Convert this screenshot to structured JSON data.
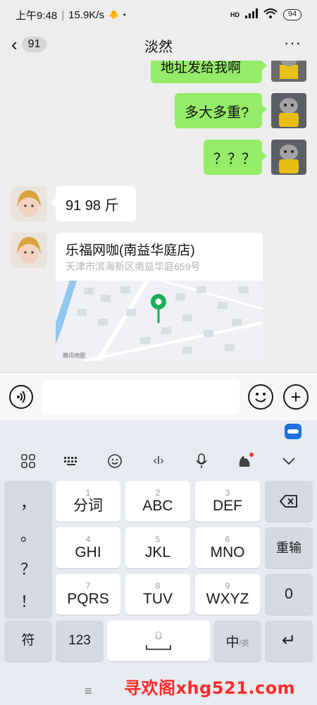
{
  "status_bar": {
    "time": "上午9:48",
    "speed": "15.9K/s",
    "network": "HD",
    "battery": "94"
  },
  "header": {
    "back_count": "91",
    "title": "淡然"
  },
  "messages": {
    "m0": "地址发给我啊",
    "m1": "多大多重?",
    "m2": "？？？",
    "m3": "91  98 斤",
    "location": {
      "name": "乐福网咖(南益华庭店)",
      "address": "天津市滨海新区南益华庭659号",
      "map_credit": "腾讯地图"
    }
  },
  "input": {
    "placeholder": ""
  },
  "keyboard": {
    "toolbar": [
      "grid-icon",
      "keyboard-icon",
      "emoji-icon",
      "cursor-icon",
      "mic-icon",
      "skin-icon",
      "collapse-icon"
    ],
    "symbols": [
      "，",
      "。",
      "？",
      "！"
    ],
    "keys": [
      {
        "num": "1",
        "label": "分词"
      },
      {
        "num": "2",
        "label": "ABC"
      },
      {
        "num": "3",
        "label": "DEF"
      },
      {
        "num": "4",
        "label": "GHI"
      },
      {
        "num": "5",
        "label": "JKL"
      },
      {
        "num": "6",
        "label": "MNO"
      },
      {
        "num": "7",
        "label": "PQRS"
      },
      {
        "num": "8",
        "label": "TUV"
      },
      {
        "num": "9",
        "label": "WXYZ"
      }
    ],
    "backspace": "⌫",
    "reenter": "重输",
    "zero": "0",
    "fu": "符",
    "num_switch": "123",
    "lang_main": "中",
    "lang_sub": "/英",
    "enter": "↵"
  },
  "watermark": "寻欢阁xhg521.com"
}
